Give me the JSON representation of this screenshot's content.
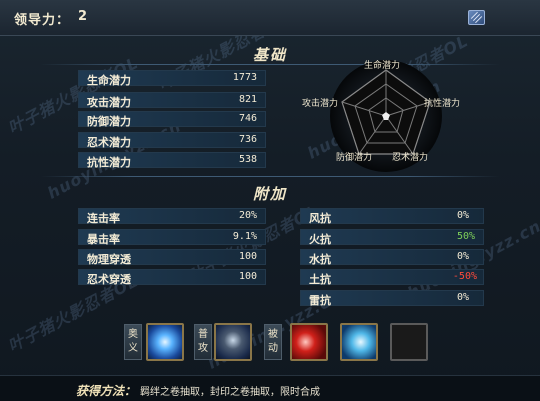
{
  "header": {
    "lead_label": "领导力：",
    "lead_value": "2",
    "corner_icon": "resize-icon"
  },
  "basic": {
    "title": "基础",
    "stats": [
      {
        "label": "生命潜力",
        "value": "1773"
      },
      {
        "label": "攻击潜力",
        "value": "821"
      },
      {
        "label": "防御潜力",
        "value": "746"
      },
      {
        "label": "忍术潜力",
        "value": "736"
      },
      {
        "label": "抗性潜力",
        "value": "538"
      }
    ],
    "radar_labels": [
      "生命潜力",
      "抗性潜力",
      "忍术潜力",
      "防御潜力",
      "攻击潜力"
    ]
  },
  "extra": {
    "title": "附加",
    "left": [
      {
        "label": "连击率",
        "value": "20%"
      },
      {
        "label": "暴击率",
        "value": "9.1%"
      },
      {
        "label": "物理穿透",
        "value": "100"
      },
      {
        "label": "忍术穿透",
        "value": "100"
      }
    ],
    "right": [
      {
        "label": "风抗",
        "value": "0%",
        "color": "#f4ecd6"
      },
      {
        "label": "火抗",
        "value": "50%",
        "color": "#7ed05a"
      },
      {
        "label": "水抗",
        "value": "0%",
        "color": "#f4ecd6"
      },
      {
        "label": "土抗",
        "value": "-50%",
        "color": "#ff4a3a"
      },
      {
        "label": "雷抗",
        "value": "0%",
        "color": "#f4ecd6"
      }
    ]
  },
  "skills": {
    "tags": [
      "奥义",
      "普攻",
      "被动"
    ],
    "icons": [
      "water-orb-icon",
      "fist-icon",
      "red-flame-icon",
      "ice-dragon-icon",
      "empty-slot-icon"
    ]
  },
  "footer": {
    "label": "获得方法：",
    "text": "羁绊之卷抽取，封印之卷抽取，限时合成"
  },
  "watermarks": [
    "叶子猪火影忍者OL",
    "huoying.yzz.cn"
  ]
}
